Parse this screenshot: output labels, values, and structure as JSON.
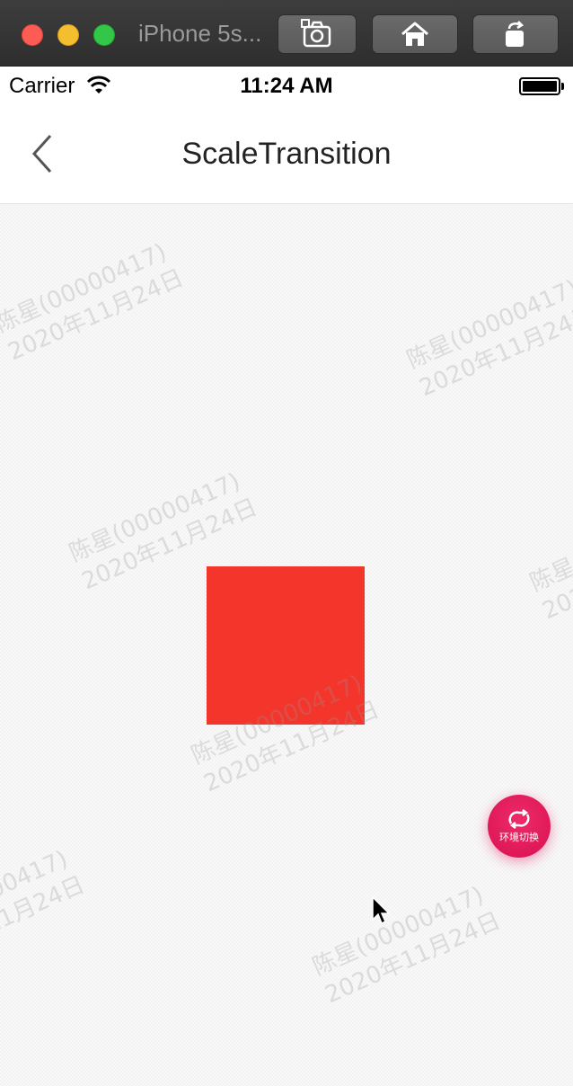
{
  "window": {
    "title": "iPhone 5s..."
  },
  "status_bar": {
    "carrier": "Carrier",
    "time": "11:24 AM"
  },
  "nav": {
    "title": "ScaleTransition"
  },
  "watermark": {
    "line1": "陈星(00000417)",
    "line2": "2020年11月24日"
  },
  "fab": {
    "label": "环境切换"
  },
  "colors": {
    "box": "#f4352b",
    "fab": "#e81e63"
  },
  "icons": {
    "screenshot": "camera-icon",
    "home": "home-icon",
    "rotate": "rotate-icon",
    "back": "chevron-left-icon",
    "fab": "switch-refresh-icon"
  }
}
